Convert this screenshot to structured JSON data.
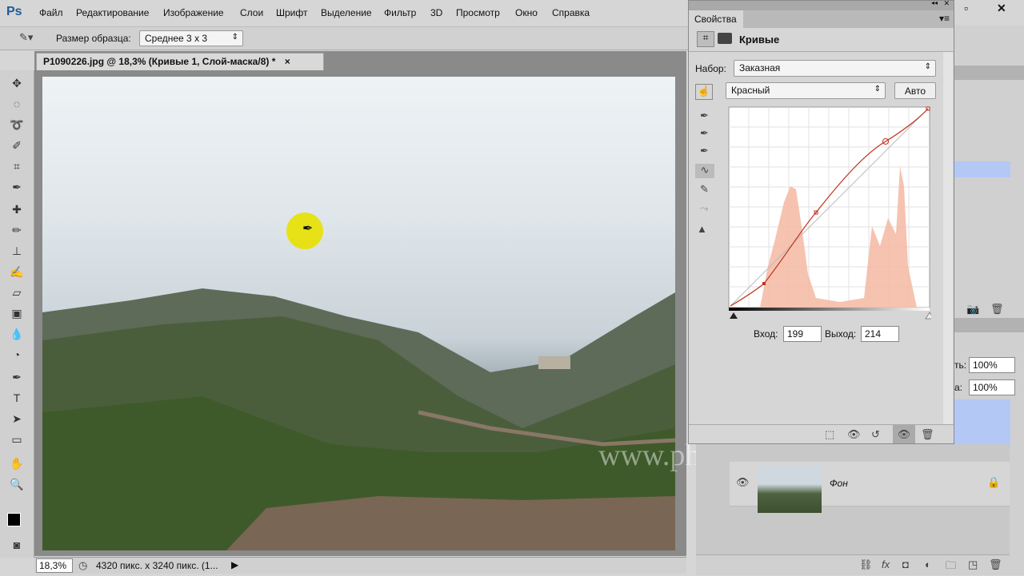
{
  "app": {
    "logo": "Ps"
  },
  "menu": [
    "Файл",
    "Редактирование",
    "Изображение",
    "Слои",
    "Шрифт",
    "Выделение",
    "Фильтр",
    "3D",
    "Просмотр",
    "Окно",
    "Справка"
  ],
  "options": {
    "sample_label": "Размер образца:",
    "sample_value": "Среднее 3 x 3"
  },
  "document": {
    "tab_title": "P1090226.jpg @ 18,3% (Кривые 1, Слой-маска/8) *",
    "close": "×"
  },
  "status": {
    "zoom": "18,3%",
    "info": "4320 пикс. x 3240 пикс. (1..."
  },
  "properties": {
    "panel_title": "Свойства",
    "adjustment": "Кривые",
    "preset_label": "Набор:",
    "preset_value": "Заказная",
    "channel_value": "Красный",
    "auto_label": "Авто",
    "input_label": "Вход:",
    "input_value": "199",
    "output_label": "Выход:",
    "output_value": "214"
  },
  "layers": {
    "opacity_label": "ть:",
    "opacity_value": "100%",
    "fill_label": "а:",
    "fill_value": "100%",
    "background_layer": "Фон"
  },
  "watermark": "www.photoshopsunduchok.ru"
}
